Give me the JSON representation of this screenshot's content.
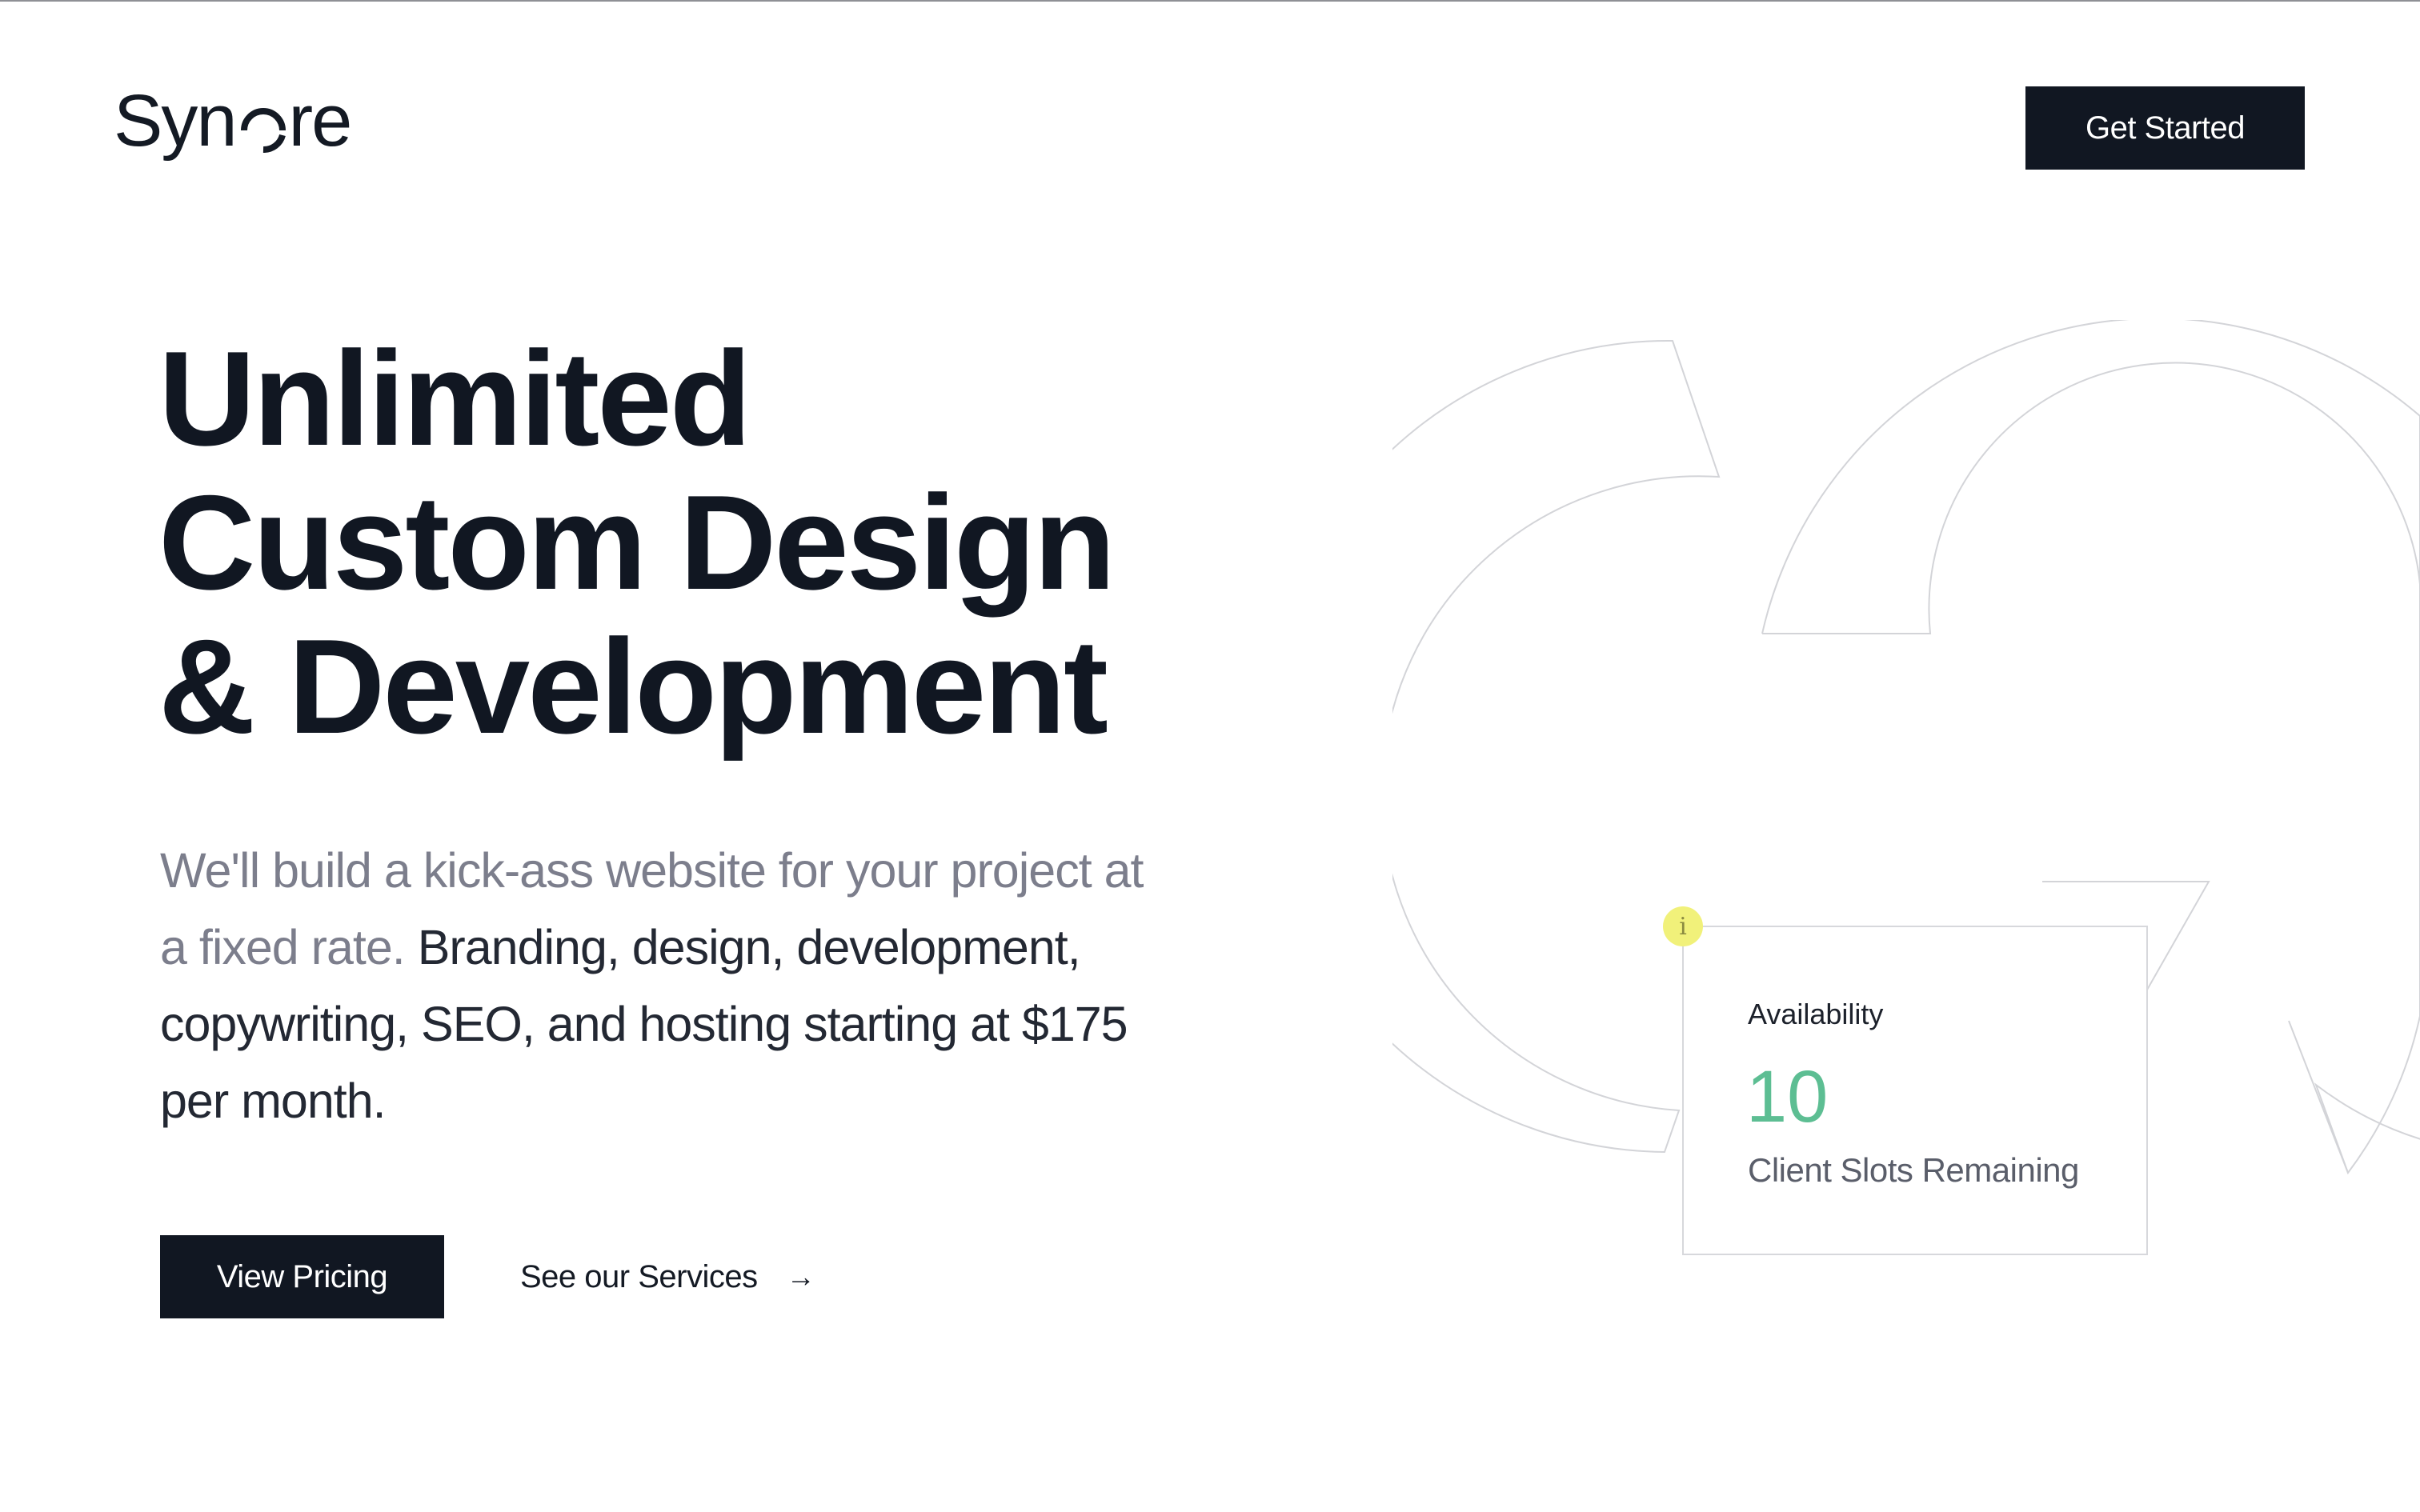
{
  "header": {
    "logo_text_start": "Syn",
    "logo_text_end": "re",
    "cta_label": "Get Started"
  },
  "hero": {
    "title_lines": [
      "Unlimited",
      "Custom Design",
      "& Development"
    ],
    "description_muted": "We'll build a kick-ass website for your project at a fixed rate.",
    "description_main": "Branding, design, development, copywriting, SEO, and hosting starting at $175 per month.",
    "primary_button": "View Pricing",
    "secondary_link": "See our Services",
    "secondary_link_icon": "arrow-right-icon"
  },
  "availability": {
    "info_icon": "i",
    "label": "Availability",
    "count": "10",
    "caption": "Client Slots Remaining"
  },
  "colors": {
    "dark": "#111722",
    "muted_text": "#7c7e8c",
    "accent_green": "#5dbe93",
    "info_yellow": "#f1f17a"
  }
}
